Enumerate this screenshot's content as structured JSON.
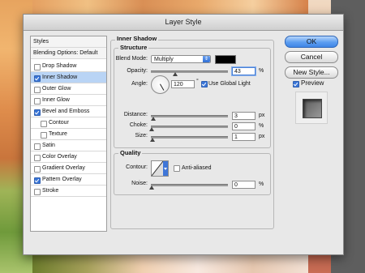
{
  "window": {
    "title": "Layer Style"
  },
  "sidebar": {
    "header": "Styles",
    "blending": "Blending Options: Default",
    "items": [
      {
        "label": "Drop Shadow",
        "checked": false
      },
      {
        "label": "Inner Shadow",
        "checked": true,
        "selected": true
      },
      {
        "label": "Outer Glow",
        "checked": false
      },
      {
        "label": "Inner Glow",
        "checked": false
      },
      {
        "label": "Bevel and Emboss",
        "checked": true
      },
      {
        "label": "Contour",
        "checked": false,
        "sub": true
      },
      {
        "label": "Texture",
        "checked": false,
        "sub": true
      },
      {
        "label": "Satin",
        "checked": false
      },
      {
        "label": "Color Overlay",
        "checked": false
      },
      {
        "label": "Gradient Overlay",
        "checked": false
      },
      {
        "label": "Pattern Overlay",
        "checked": true
      },
      {
        "label": "Stroke",
        "checked": false
      }
    ]
  },
  "panel": {
    "title": "Inner Shadow",
    "structure": {
      "title": "Structure",
      "blend_mode_label": "Blend Mode:",
      "blend_mode_value": "Multiply",
      "blend_color": "#000000",
      "opacity_label": "Opacity:",
      "opacity_value": "43",
      "opacity_unit": "%",
      "opacity_level": 0.43,
      "angle_label": "Angle:",
      "angle_value": "120",
      "angle_unit": "°",
      "global_light_label": "Use Global Light",
      "global_light_checked": true,
      "distance_label": "Distance:",
      "distance_value": "3",
      "distance_unit": "px",
      "choke_label": "Choke:",
      "choke_value": "0",
      "choke_unit": "%",
      "size_label": "Size:",
      "size_value": "1",
      "size_unit": "px"
    },
    "quality": {
      "title": "Quality",
      "contour_label": "Contour:",
      "antialiased_label": "Anti-aliased",
      "antialiased_checked": false,
      "noise_label": "Noise:",
      "noise_value": "0",
      "noise_unit": "%"
    }
  },
  "buttons": {
    "ok": "OK",
    "cancel": "Cancel",
    "new_style": "New Style...",
    "preview": "Preview",
    "preview_checked": true
  }
}
